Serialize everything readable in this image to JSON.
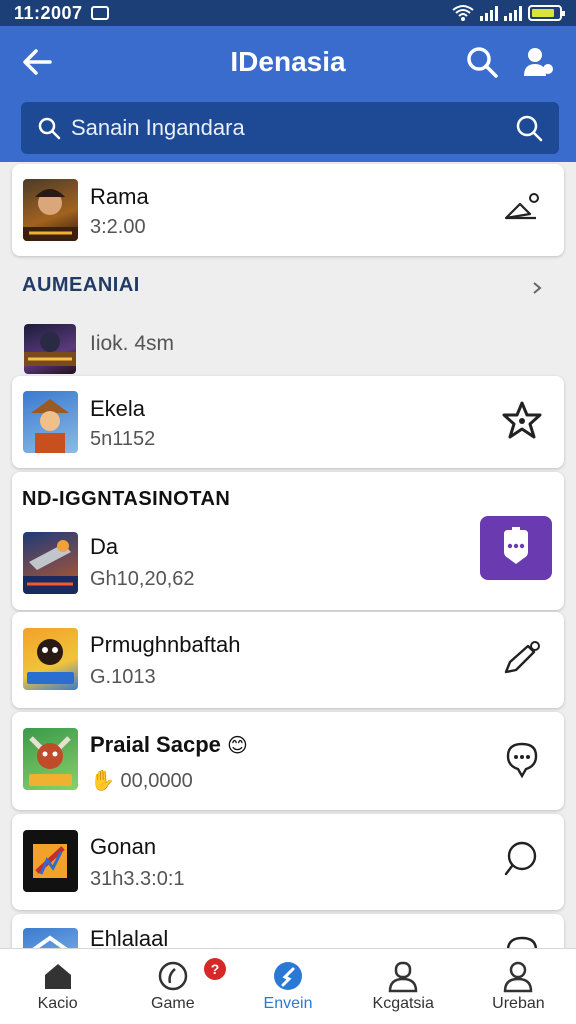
{
  "status_bar": {
    "time": "11:2007"
  },
  "app_bar": {
    "title": "IDenasia"
  },
  "search": {
    "placeholder": "Sanain Ingandara"
  },
  "list": {
    "item1": {
      "name": "Rama",
      "meta": "3:2.00"
    },
    "section1": {
      "title": "AUMEANIAI"
    },
    "item2": {
      "name": "",
      "meta": "Iiok. 4sm"
    },
    "item3": {
      "name": "Ekela",
      "meta": "5n1152"
    },
    "section2": {
      "title": "ND-IGGNTASINOTAN"
    },
    "item4": {
      "name": "Da",
      "meta": "Gh10,20,62"
    },
    "item5": {
      "name": "Prmughnbaftah",
      "meta": "G.1013"
    },
    "item6": {
      "name": "Praial Sacpe",
      "meta": "00,0000"
    },
    "item7": {
      "name": "Gonan",
      "meta": "31h3.3:0:1"
    },
    "item8": {
      "name": "Ehlalaal"
    }
  },
  "bottom_nav": {
    "items": [
      {
        "label": "Kacio"
      },
      {
        "label": "Game"
      },
      {
        "label": "Envein"
      },
      {
        "label": "Kcgatsia"
      },
      {
        "label": "Ureban"
      }
    ],
    "badge": "?"
  },
  "colors": {
    "app_bar": "#3a6ccd",
    "status_bar": "#1d3f78",
    "search_bg": "#1e4a95",
    "accent": "#2a7ad5",
    "purple_button": "#6a3bb0"
  },
  "icons": [
    "back-arrow-icon",
    "search-icon",
    "profile-icon",
    "pen-icon",
    "star-icon",
    "chat-icon",
    "speech-bubble-icon",
    "home-icon",
    "game-icon",
    "explore-icon",
    "person-icon"
  ]
}
